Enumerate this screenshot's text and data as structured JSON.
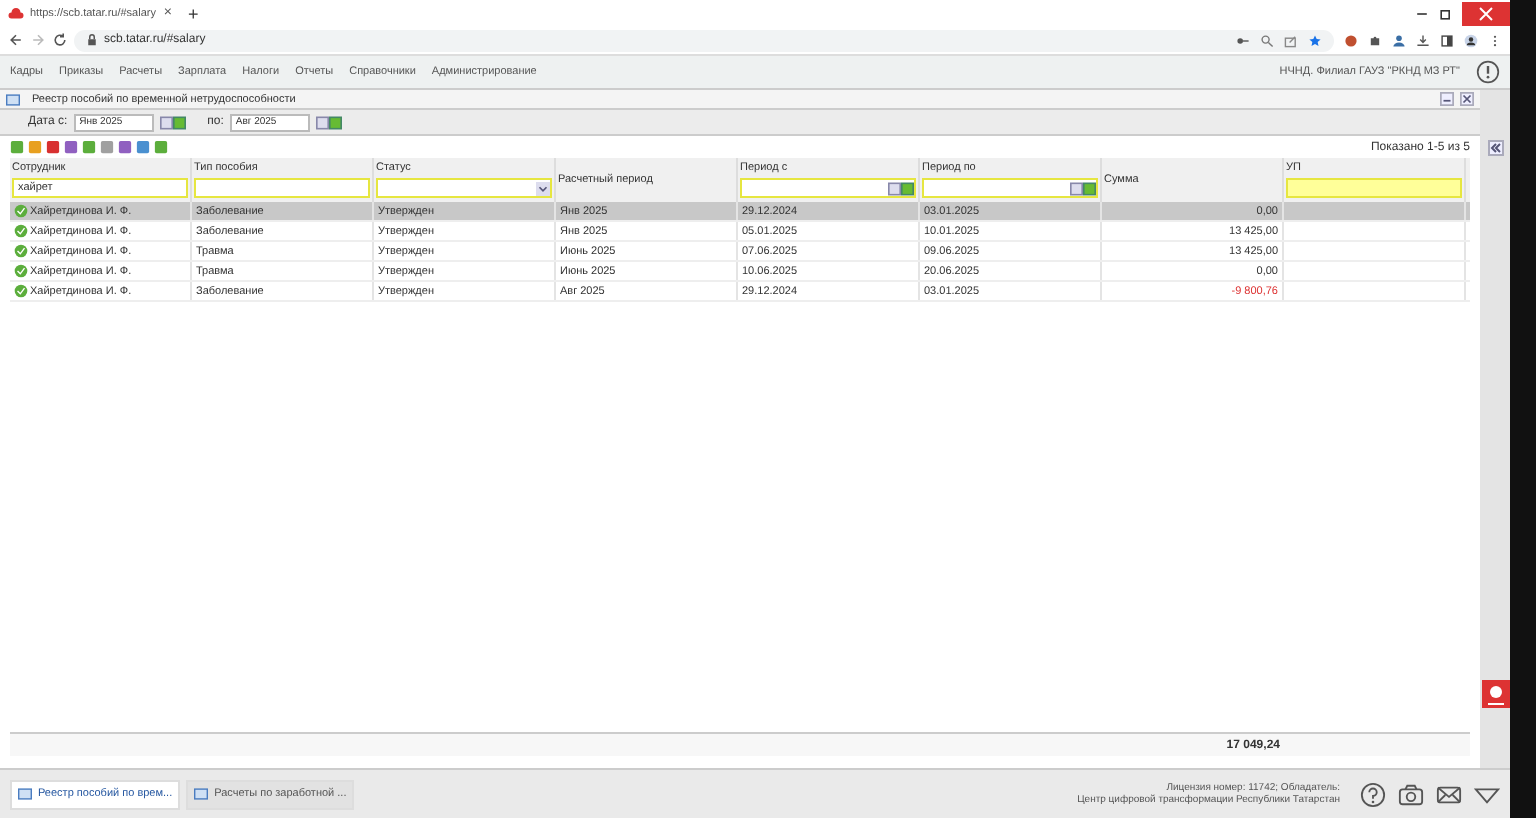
{
  "browser": {
    "tab_title": "https://scb.tatar.ru/#salary",
    "new_tab": "+",
    "close_tab": "×",
    "url": "scb.tatar.ru/#salary"
  },
  "menu": {
    "items": [
      "Кадры",
      "Приказы",
      "Расчеты",
      "Зарплата",
      "Налоги",
      "Отчеты",
      "Справочники",
      "Администрирование"
    ],
    "organization": "НЧНД. Филиал ГАУЗ \"РКНД МЗ РТ\""
  },
  "panel": {
    "title": "Реестр пособий по временной нетрудоспособности",
    "date_from_label": "Дата с:",
    "date_from": "Янв 2025",
    "date_to_label": "по:",
    "date_to": "Авг 2025",
    "paging": "Показано 1-5 из 5"
  },
  "table": {
    "columns": [
      "Сотрудник",
      "Тип пособия",
      "Статус",
      "Расчетный период",
      "Период с",
      "Период по",
      "Сумма",
      "УП"
    ],
    "employee_filter": "хайрет",
    "rows": [
      {
        "employee": "Хайретдинова И. Ф.",
        "type": "Заболевание",
        "status": "Утвержден",
        "period": "Янв 2025",
        "from": "29.12.2024",
        "to": "03.01.2025",
        "amount": "0,00",
        "negative": false,
        "selected": true
      },
      {
        "employee": "Хайретдинова И. Ф.",
        "type": "Заболевание",
        "status": "Утвержден",
        "period": "Янв 2025",
        "from": "05.01.2025",
        "to": "10.01.2025",
        "amount": "13 425,00",
        "negative": false,
        "selected": false
      },
      {
        "employee": "Хайретдинова И. Ф.",
        "type": "Травма",
        "status": "Утвержден",
        "period": "Июнь 2025",
        "from": "07.06.2025",
        "to": "09.06.2025",
        "amount": "13 425,00",
        "negative": false,
        "selected": false
      },
      {
        "employee": "Хайретдинова И. Ф.",
        "type": "Травма",
        "status": "Утвержден",
        "period": "Июнь 2025",
        "from": "10.06.2025",
        "to": "20.06.2025",
        "amount": "0,00",
        "negative": false,
        "selected": false
      },
      {
        "employee": "Хайретдинова И. Ф.",
        "type": "Заболевание",
        "status": "Утвержден",
        "period": "Авг 2025",
        "from": "29.12.2024",
        "to": "03.01.2025",
        "amount": "-9 800,76",
        "negative": true,
        "selected": false
      }
    ],
    "total": "17 049,24"
  },
  "taskbar": {
    "tabs": [
      {
        "label": "Реестр пособий по врем...",
        "selected": true
      },
      {
        "label": "Расчеты по заработной ...",
        "selected": false
      }
    ],
    "license_line_1": "Лицензия номер: 11742; Обладатель:",
    "license_line_2": "Центр цифровой трансформации Республики Татарстан"
  }
}
